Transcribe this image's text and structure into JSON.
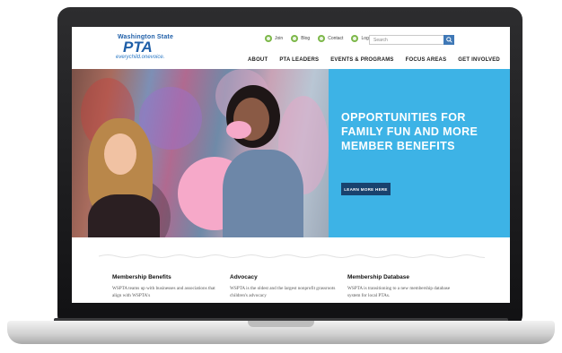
{
  "header": {
    "logo": {
      "line1": "Washington State",
      "mark": "PTA",
      "tagline": "everychild.onevoice."
    },
    "utility_links": [
      {
        "label": "Join",
        "icon": "join-icon"
      },
      {
        "label": "Blog",
        "icon": "blog-icon"
      },
      {
        "label": "Contact",
        "icon": "contact-icon"
      },
      {
        "label": "Log In",
        "icon": "login-icon"
      }
    ],
    "search": {
      "placeholder": "Search"
    },
    "nav": [
      "ABOUT",
      "PTA LEADERS",
      "EVENTS & PROGRAMS",
      "FOCUS AREAS",
      "GET INVOLVED"
    ]
  },
  "hero": {
    "headline": "OPPORTUNITIES FOR FAMILY FUN AND MORE MEMBER BENEFITS",
    "button": "LEARN MORE HERE"
  },
  "columns": [
    {
      "title": "Membership Benefits",
      "text": "WSPTA teams up with businesses and associations that align with WSPTA's"
    },
    {
      "title": "Advocacy",
      "text": "WSPTA is the oldest and the largest nonprofit grassroots children's advocacy"
    },
    {
      "title": "Membership Database",
      "text": "WSPTA is transitioning to a new membership database system for local PTAs."
    }
  ],
  "colors": {
    "hero_blue": "#3db3e6",
    "button_navy": "#19426e",
    "brand_blue": "#1f5fa8",
    "icon_green": "#7db84a"
  }
}
